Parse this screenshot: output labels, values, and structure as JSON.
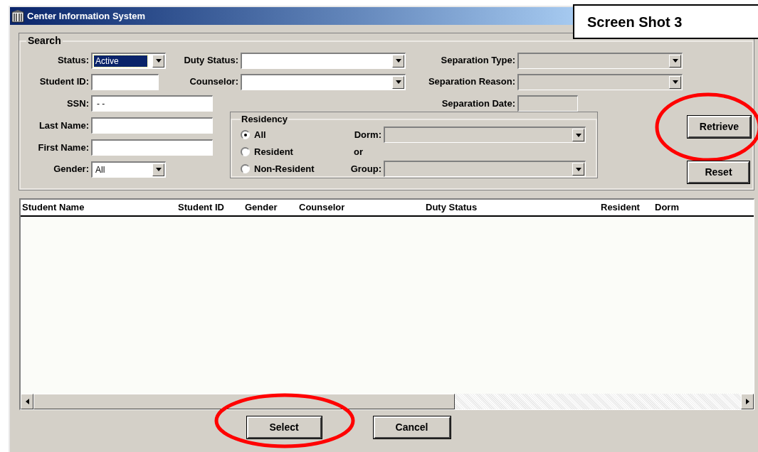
{
  "window": {
    "title": "Center Information System"
  },
  "annotation": {
    "label": "Screen Shot 3"
  },
  "search": {
    "title": "Search",
    "status": {
      "label": "Status:",
      "value": "Active",
      "highlighted": true,
      "disabled": false
    },
    "duty_status": {
      "label": "Duty Status:",
      "disabled": false
    },
    "separation_type": {
      "label": "Separation Type:",
      "disabled": true
    },
    "student_id": {
      "label": "Student ID:",
      "disabled": false
    },
    "counselor": {
      "label": "Counselor:",
      "disabled": false
    },
    "separation_reason": {
      "label": "Separation Reason:",
      "disabled": true
    },
    "ssn": {
      "label": "SSN:",
      "value": "- -",
      "disabled": false
    },
    "separation_date": {
      "label": "Separation Date:",
      "disabled": true
    },
    "last_name": {
      "label": "Last Name:",
      "disabled": false
    },
    "first_name": {
      "label": "First Name:",
      "disabled": false
    },
    "gender": {
      "label": "Gender:",
      "value": "All",
      "highlighted": false,
      "disabled": false
    },
    "residency": {
      "title": "Residency",
      "options": [
        {
          "label": "All",
          "selected": true
        },
        {
          "label": "Resident",
          "selected": false
        },
        {
          "label": "Non-Resident",
          "selected": false
        }
      ],
      "dorm": {
        "label": "Dorm:",
        "disabled": true
      },
      "or_label": "or",
      "group": {
        "label": "Group:",
        "disabled": true
      }
    },
    "buttons": [
      {
        "label": "Retrieve",
        "circled": true
      },
      {
        "label": "Reset",
        "circled": false
      }
    ]
  },
  "table": {
    "columns": [
      "Student Name",
      "Student ID",
      "Gender",
      "Counselor",
      "Duty Status",
      "Resident",
      "Dorm"
    ]
  },
  "buttons": [
    {
      "label": "Select",
      "circled": true
    },
    {
      "label": "Cancel",
      "circled": false
    }
  ]
}
